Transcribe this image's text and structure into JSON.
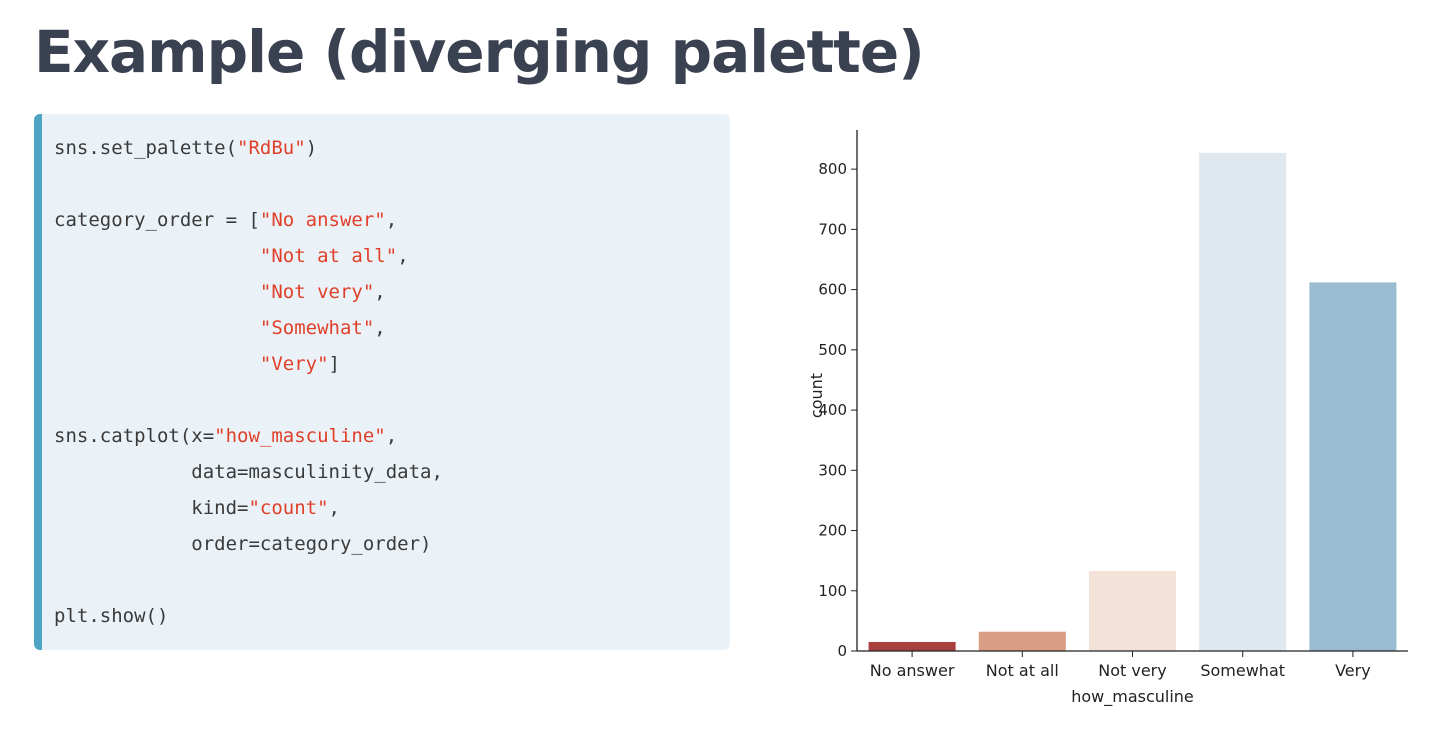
{
  "slide": {
    "title": "Example (diverging palette)"
  },
  "code": {
    "lines": [
      [
        {
          "t": "sns.set_palette("
        },
        {
          "t": "\"RdBu\"",
          "s": true
        },
        {
          "t": ")"
        }
      ],
      [],
      [
        {
          "t": "category_order = ["
        },
        {
          "t": "\"No answer\"",
          "s": true
        },
        {
          "t": ","
        }
      ],
      [
        {
          "t": "                  "
        },
        {
          "t": "\"Not at all\"",
          "s": true
        },
        {
          "t": ","
        }
      ],
      [
        {
          "t": "                  "
        },
        {
          "t": "\"Not very\"",
          "s": true
        },
        {
          "t": ","
        }
      ],
      [
        {
          "t": "                  "
        },
        {
          "t": "\"Somewhat\"",
          "s": true
        },
        {
          "t": ","
        }
      ],
      [
        {
          "t": "                  "
        },
        {
          "t": "\"Very\"",
          "s": true
        },
        {
          "t": "]"
        }
      ],
      [],
      [
        {
          "t": "sns.catplot(x="
        },
        {
          "t": "\"how_masculine\"",
          "s": true
        },
        {
          "t": ","
        }
      ],
      [
        {
          "t": "            data=masculinity_data,"
        }
      ],
      [
        {
          "t": "            kind="
        },
        {
          "t": "\"count\"",
          "s": true
        },
        {
          "t": ","
        }
      ],
      [
        {
          "t": "            order=category_order)"
        }
      ],
      [],
      [
        {
          "t": "plt.show()"
        }
      ]
    ]
  },
  "chart_data": {
    "type": "bar",
    "categories": [
      "No answer",
      "Not at all",
      "Not very",
      "Somewhat",
      "Very"
    ],
    "values": [
      15,
      32,
      133,
      827,
      612
    ],
    "colors": [
      "#a8403e",
      "#d89d84",
      "#f2e2d7",
      "#dee8ee",
      "#9abcd1"
    ],
    "xlabel": "how_masculine",
    "ylabel": "count",
    "ylim": [
      0,
      865
    ],
    "yticks": [
      0,
      100,
      200,
      300,
      400,
      500,
      600,
      700,
      800
    ],
    "grid": false,
    "legend": "none"
  }
}
